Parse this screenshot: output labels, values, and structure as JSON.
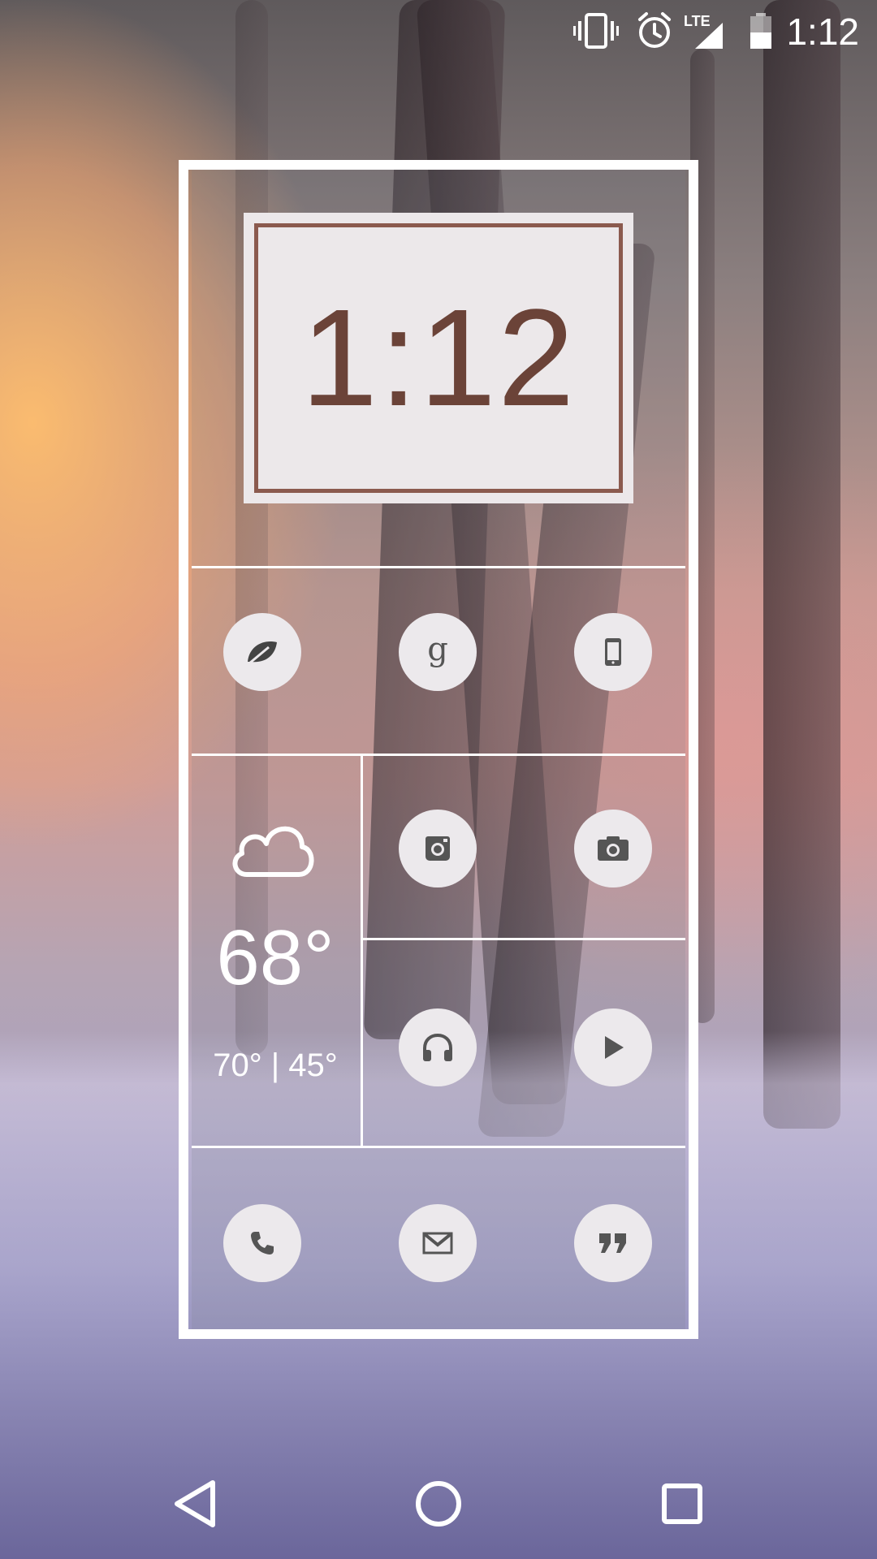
{
  "status_bar": {
    "time": "1:12",
    "icons": [
      "vibrate-icon",
      "alarm-icon",
      "lte-signal-icon",
      "battery-icon"
    ],
    "network_label": "LTE"
  },
  "widget": {
    "clock": {
      "time": "1:12"
    },
    "row1_apps": [
      {
        "name": "leaf-app-icon"
      },
      {
        "name": "google-icon",
        "glyph": "g"
      },
      {
        "name": "phone-device-icon"
      }
    ],
    "weather": {
      "icon": "cloud-icon",
      "temperature": "68°",
      "range": "70° | 45°"
    },
    "row2_apps": [
      {
        "name": "instagram-icon"
      },
      {
        "name": "camera-icon"
      },
      {
        "name": "headphones-icon"
      },
      {
        "name": "play-icon"
      }
    ],
    "dock": [
      {
        "name": "phone-call-icon"
      },
      {
        "name": "gmail-icon"
      },
      {
        "name": "hangouts-icon"
      }
    ]
  },
  "nav_bar": {
    "buttons": [
      "back-icon",
      "home-icon",
      "recents-icon"
    ]
  },
  "colors": {
    "clock_accent": "#8b5a4e",
    "icon_bg": "#ece9ec",
    "icon_fg": "#555555",
    "frame": "#ffffff"
  }
}
